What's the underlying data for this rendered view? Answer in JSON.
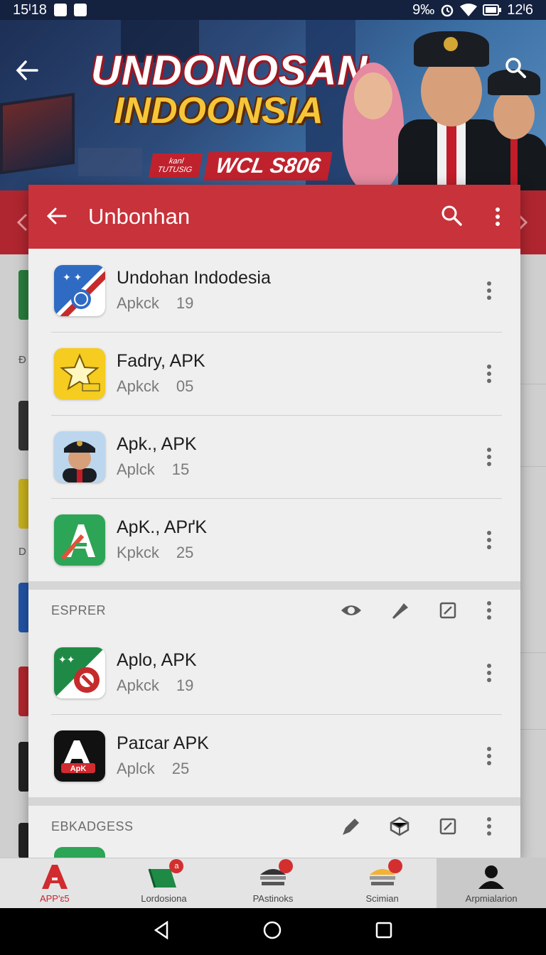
{
  "status_bar": {
    "time": "15ᴵ18",
    "right_text": "9‰",
    "battery_text": "12ᴵ6"
  },
  "banner": {
    "title": "UNDONOSAN",
    "subtitle": "INDOONSIA",
    "badge_small_line1": "kanl",
    "badge_small_line2": "TUTUSIG",
    "badge_big": "WCL S806"
  },
  "app_bar": {
    "title": "Unbonhan"
  },
  "apps": [
    {
      "name": "Undohan Indodesia",
      "meta_a": "Apkck",
      "meta_b": "19",
      "icon": "indonesia-flag-app-icon"
    },
    {
      "name": "Fadry, APK",
      "meta_a": "Apkck",
      "meta_b": "05",
      "icon": "star-app-icon"
    },
    {
      "name": "Apk., APK",
      "meta_a": "Aplck",
      "meta_b": "15",
      "icon": "pilot-avatar-app-icon"
    },
    {
      "name": "ApK., APґK",
      "meta_a": "Kpkck",
      "meta_b": "25",
      "icon": "green-a-app-icon"
    }
  ],
  "section1": {
    "title": "ESPRER"
  },
  "apps2": [
    {
      "name": "Aplo, APK",
      "meta_a": "Apkck",
      "meta_b": "19",
      "icon": "flag-swirl-app-icon"
    },
    {
      "name": "Paɪcar APK",
      "meta_a": "Aplck",
      "meta_b": "25",
      "icon": "black-apk-app-icon",
      "icon_text": "ApK"
    }
  ],
  "section2": {
    "title": "EBKADGESS"
  },
  "bottom_nav": [
    {
      "label": "APP'ɛ5",
      "badge": ""
    },
    {
      "label": "Lordosiona",
      "badge": "a"
    },
    {
      "label": "PAstinoks",
      "badge": ""
    },
    {
      "label": "Scimian",
      "badge": ""
    },
    {
      "label": "Arpmialarion",
      "badge": ""
    }
  ],
  "colors": {
    "app_bar": "#c8323a",
    "accent_red": "#c7252f",
    "card_bg": "#efefef"
  }
}
